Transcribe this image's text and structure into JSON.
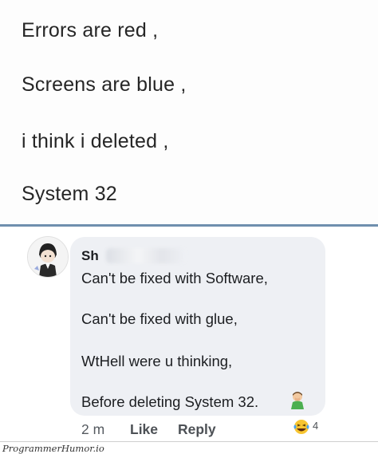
{
  "post": {
    "lines": [
      "Errors are red ,",
      "Screens are blue ,",
      "i think i deleted ,",
      "System 32"
    ]
  },
  "comment": {
    "author_visible": "Sh",
    "lines": [
      "Can't be fixed with Software,",
      "Can't be fixed with glue,",
      "WtHell were u thinking,",
      "Before deleting System 32."
    ],
    "time": "2 m",
    "like_label": "Like",
    "reply_label": "Reply",
    "reaction_count": "4",
    "reaction_icon": "laughing-emoji",
    "inline_emoji": "facepalm-emoji"
  },
  "watermark": "ProgrammerHumor.io",
  "colors": {
    "divider": "#6f8fae",
    "bubble": "#eef0f4",
    "text": "#1c1e21",
    "meta": "#4d5156"
  }
}
